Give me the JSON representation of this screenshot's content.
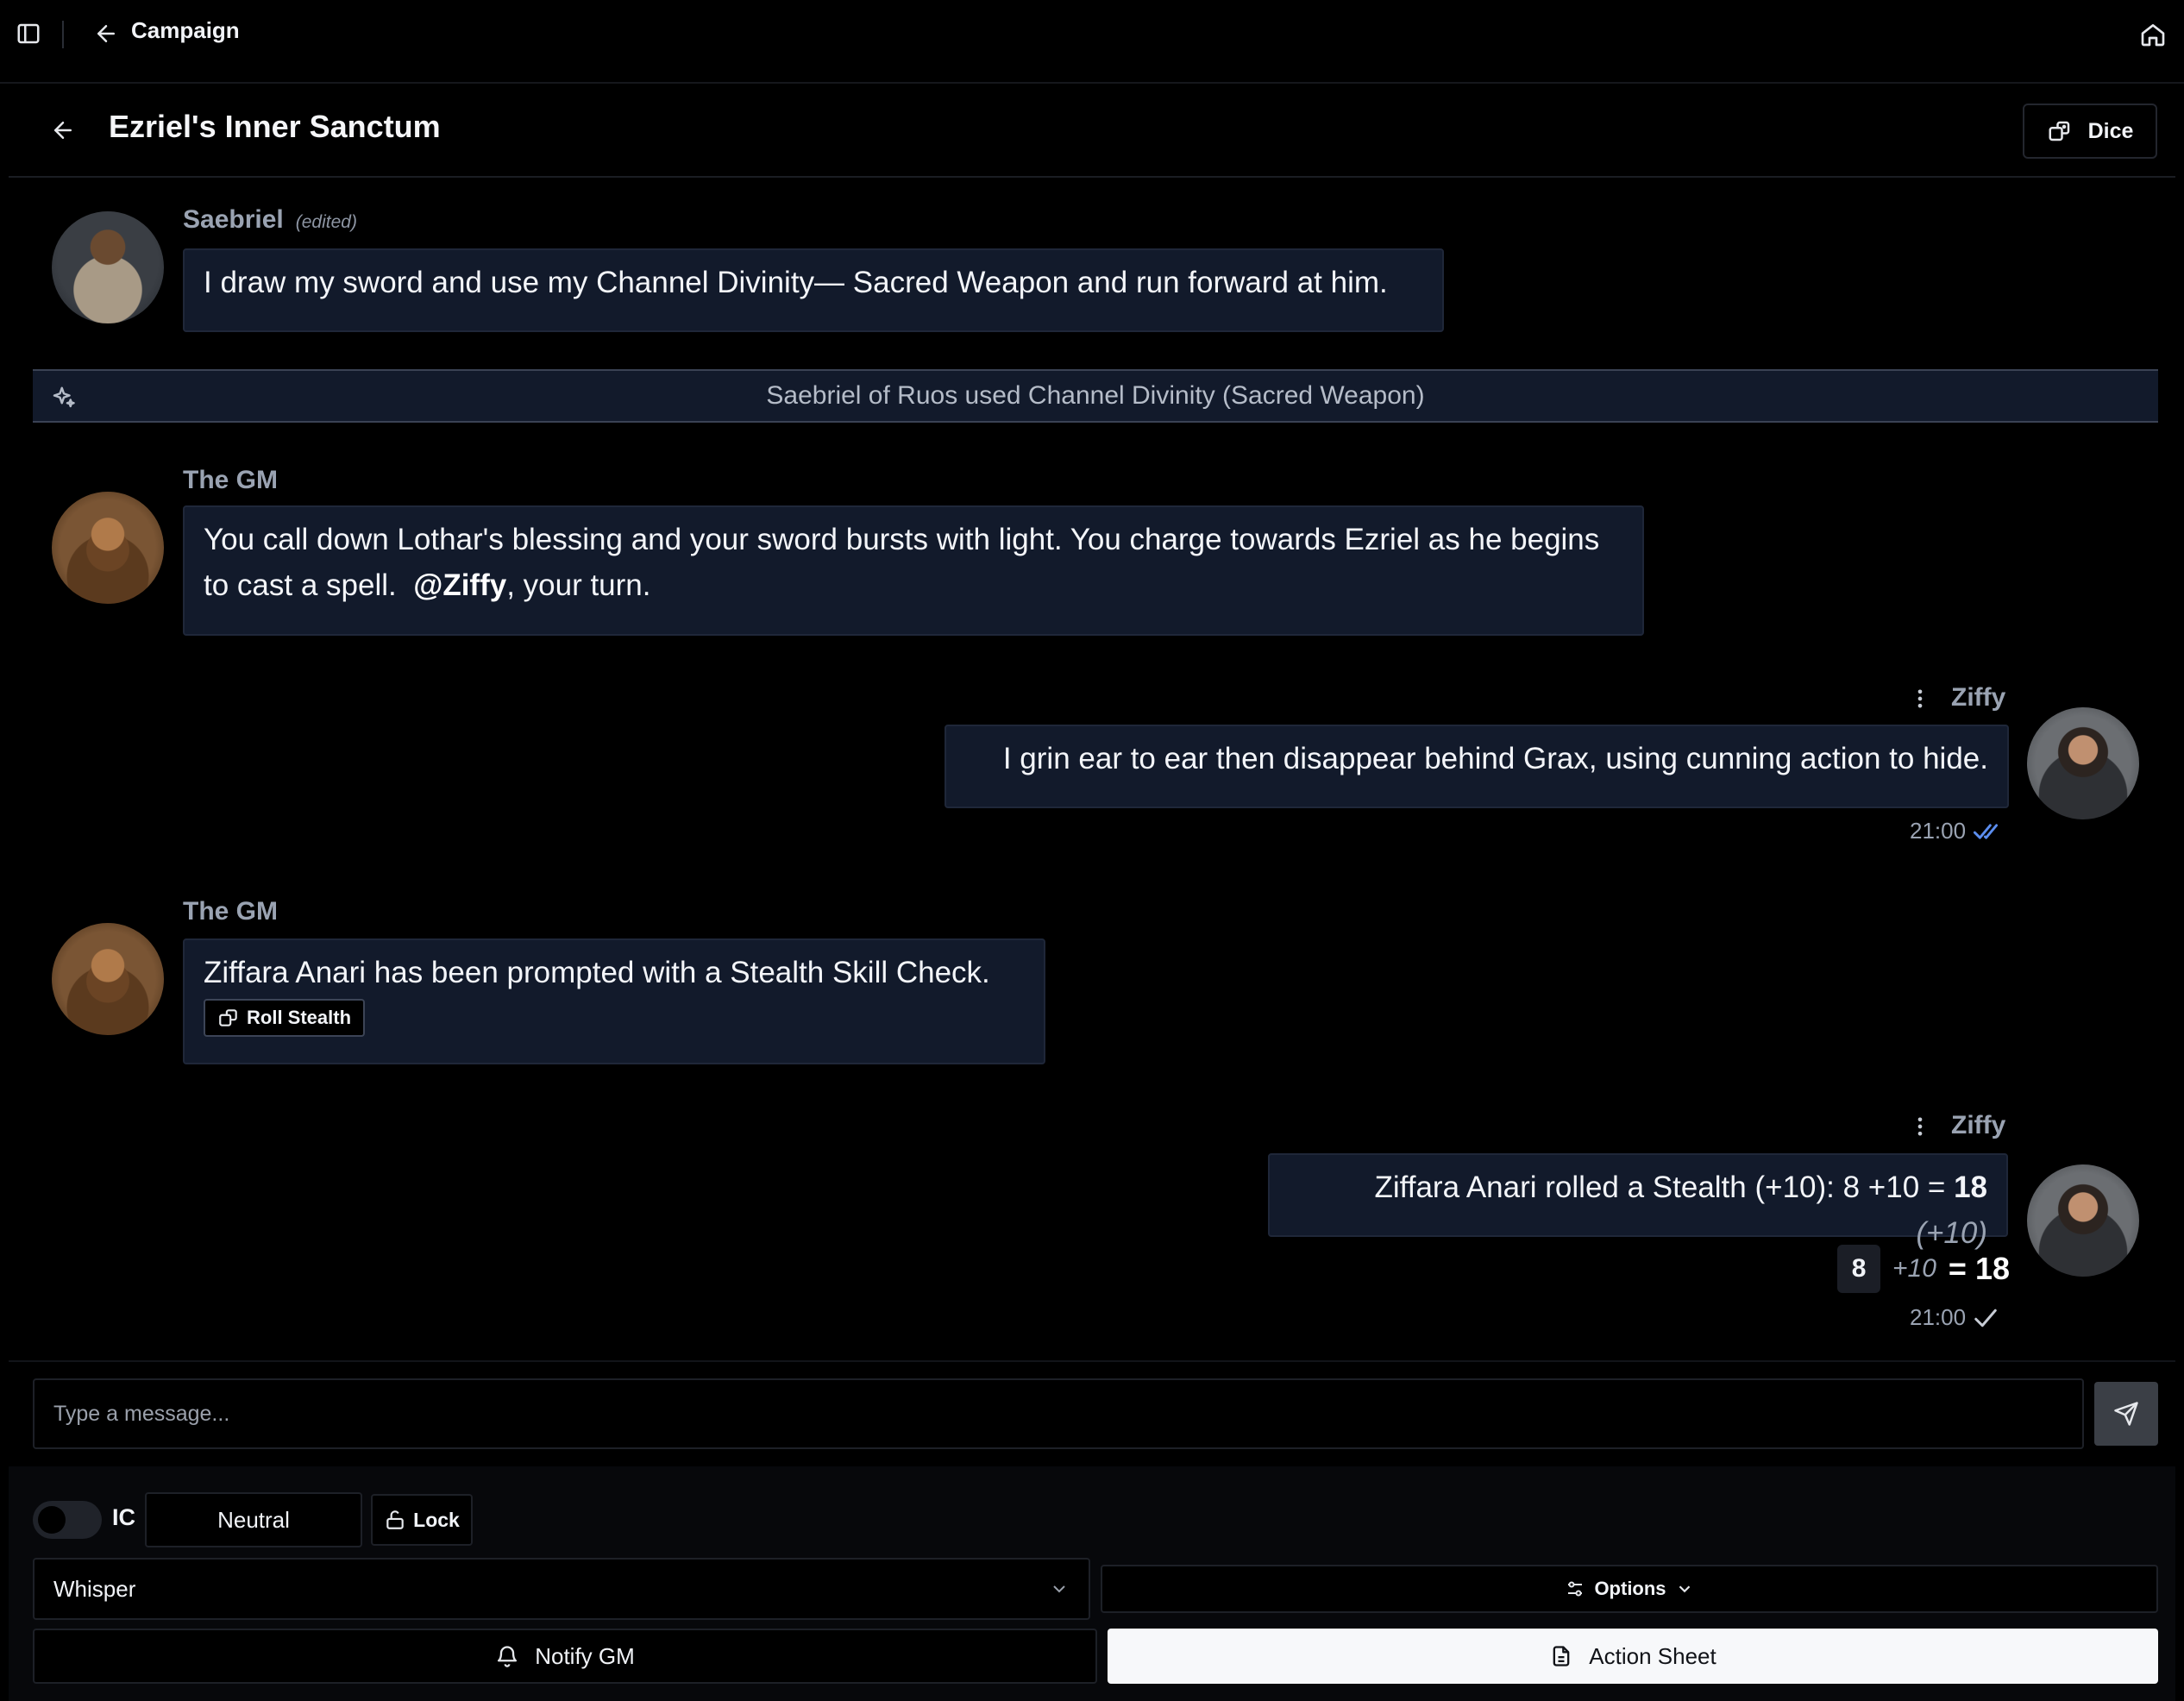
{
  "topbar": {
    "title": "Campaign",
    "icons": [
      "sidebar-toggle-icon",
      "arrow-left-icon",
      "home-icon"
    ]
  },
  "channel": {
    "title": "Ezriel's Inner Sanctum",
    "dice_label": "Dice"
  },
  "messages": [
    {
      "author": "Saebriel",
      "edited": "(edited)",
      "text": "I draw my sword and use my Channel Divinity— Sacred Weapon and run forward at him."
    },
    {
      "system": "Saebriel of Ruos used Channel Divinity (Sacred Weapon)",
      "icon": "sparkles-icon"
    },
    {
      "author": "The GM",
      "text_before": "You call down Lothar's blessing and your sword bursts with light. You charge towards Ezriel as he begins to cast a spell.",
      "mention": "@Ziffy",
      "text_after": ", your turn."
    },
    {
      "author": "Ziffy",
      "text": "I grin ear to ear then disappear behind Grax, using cunning action to hide.",
      "time": "21:00",
      "status": "read"
    },
    {
      "author": "The GM",
      "text": "Ziffara Anari has been prompted with a Stealth Skill Check.",
      "button": "Roll Stealth"
    },
    {
      "author": "Ziffy",
      "text_prefix": "Ziffara Anari rolled a Stealth (+10): 8 +10 =",
      "total": "18",
      "modifier_note": "(+10)",
      "die": "8",
      "modifier": "+10",
      "equals": "= 18",
      "time": "21:00",
      "status": "sent"
    }
  ],
  "composer": {
    "placeholder": "Type a message...",
    "ic_label": "IC",
    "neutral_label": "Neutral",
    "lock_label": "Lock",
    "whisper_label": "Whisper",
    "options_label": "Options",
    "notify_label": "Notify GM",
    "action_sheet_label": "Action Sheet"
  },
  "colors": {
    "bubble_bg": "#121a2b",
    "read_check": "#5b8def",
    "primary_button": "#f7f8fa"
  }
}
